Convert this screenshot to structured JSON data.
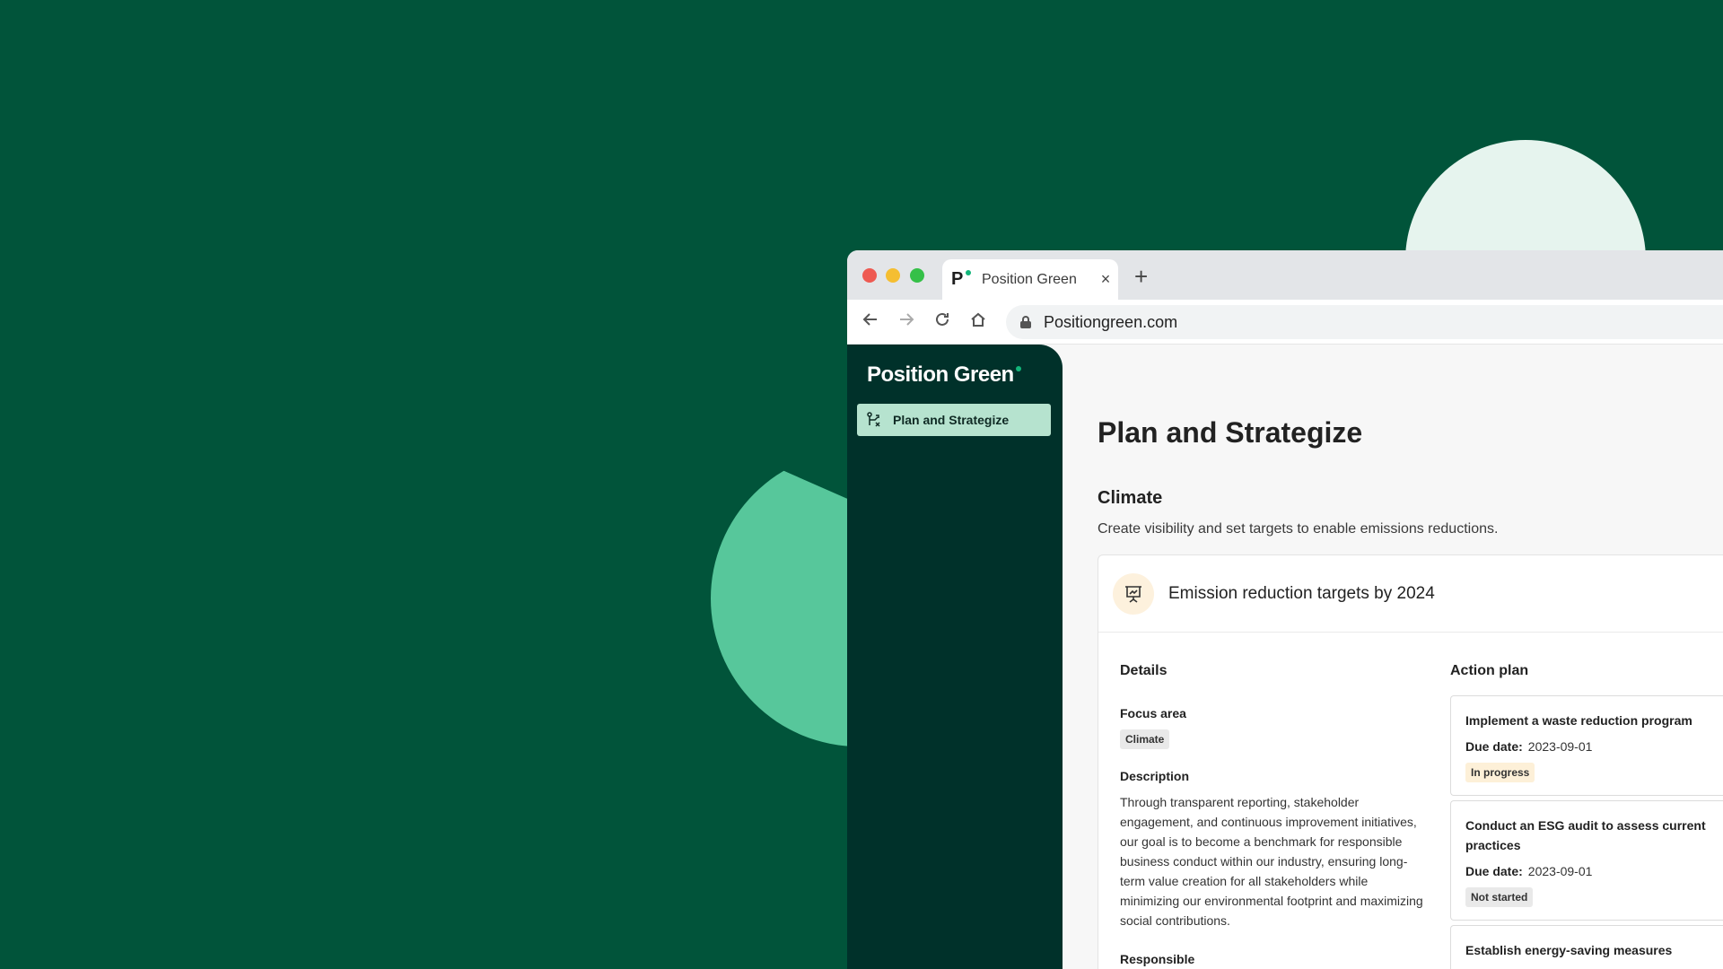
{
  "browser": {
    "tab_logo": "P",
    "tab_title": "Position Green",
    "tab_close": "×",
    "new_tab": "+",
    "url": "Positiongreen.com"
  },
  "sidebar": {
    "brand": "Position Green",
    "items": [
      {
        "label": "Plan and Strategize",
        "active": true
      }
    ]
  },
  "page": {
    "title": "Plan and Strategize",
    "section_title": "Climate",
    "section_desc": "Create visibility and set targets to enable emissions reductions."
  },
  "card": {
    "title": "Emission reduction targets by 2024",
    "details": {
      "heading": "Details",
      "focus_label": "Focus area",
      "focus_value": "Climate",
      "description_label": "Description",
      "description_text": "Through transparent reporting, stakeholder engagement, and continuous improvement initiatives, our goal is to become a benchmark for responsible business conduct within our industry, ensuring long-term value creation for all stakeholders while minimizing our environmental footprint and maximizing social contributions.",
      "responsible_label": "Responsible"
    },
    "action_plan": {
      "heading": "Action plan",
      "due_label": "Due date:",
      "items": [
        {
          "title": "Implement a waste reduction program",
          "due": "2023-09-01",
          "status": "In progress"
        },
        {
          "title": "Conduct an ESG audit to assess current practices",
          "due": "2023-09-01",
          "status": "Not started"
        },
        {
          "title": "Establish energy-saving measures",
          "due": "",
          "status": ""
        }
      ]
    }
  },
  "colors": {
    "background": "#01543A",
    "sidebar": "#00312A",
    "nav_active": "#B6E3CF",
    "accent_green": "#12B57A",
    "leaf": "#57C79B",
    "status_in_progress": "#FDF0D8",
    "status_not_started": "#E9E9E9"
  }
}
